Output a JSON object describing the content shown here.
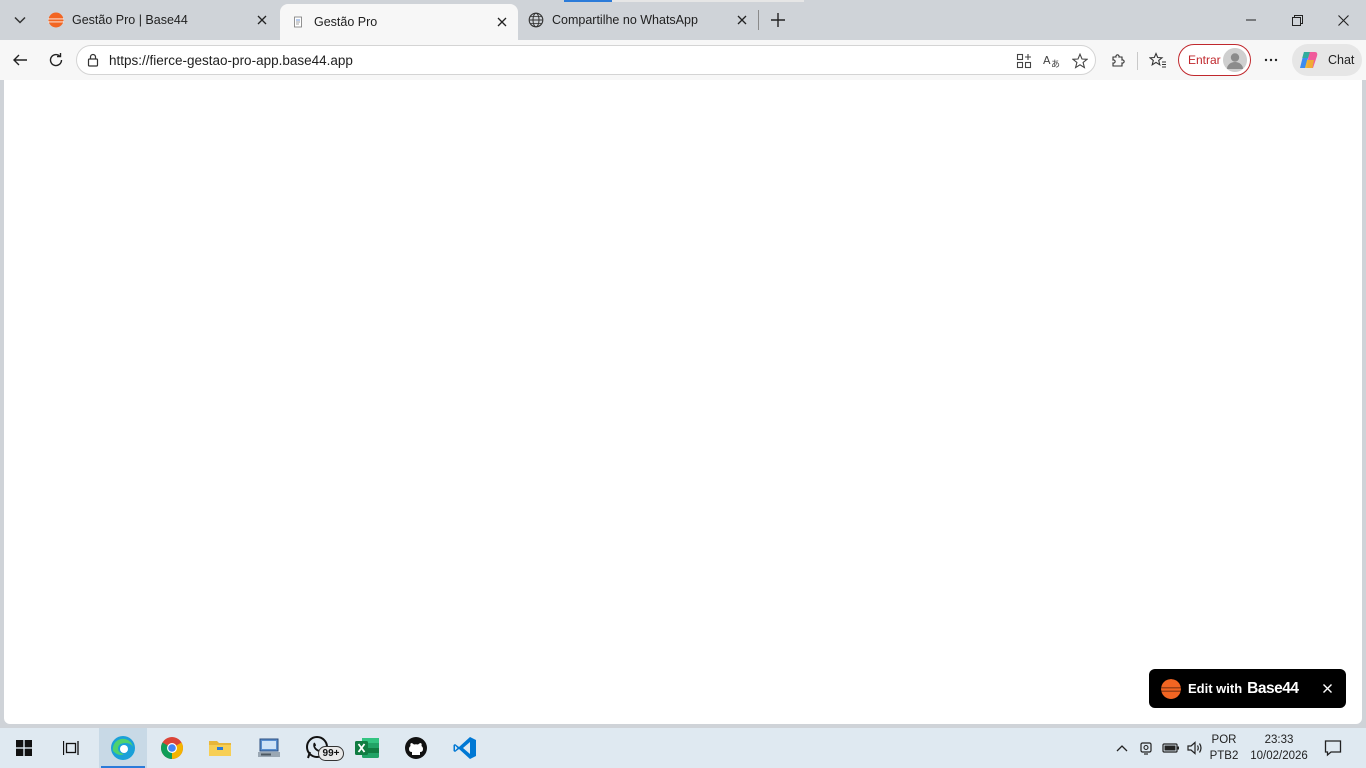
{
  "tabs": [
    {
      "title": "Gestão Pro | Base44",
      "icon": "base44-logo-icon"
    },
    {
      "title": "Gestão Pro",
      "icon": "document-icon",
      "active": true
    },
    {
      "title": "Compartilhe no WhatsApp",
      "icon": "globe-icon"
    }
  ],
  "toolbar": {
    "url": "https://fierce-gestao-pro-app.base44.app",
    "signin_label": "Entrar",
    "chat_label": "Chat"
  },
  "page": {
    "edit_label": "Edit with",
    "brand": "Base44"
  },
  "taskbar": {
    "whatsapp_badge": "99+",
    "lang_line1": "POR",
    "lang_line2": "PTB2",
    "time": "23:33",
    "date": "10/02/2026"
  },
  "colors": {
    "accent": "#2b7bd9",
    "signin": "#c0282d",
    "base44_orange": "#f26522"
  }
}
